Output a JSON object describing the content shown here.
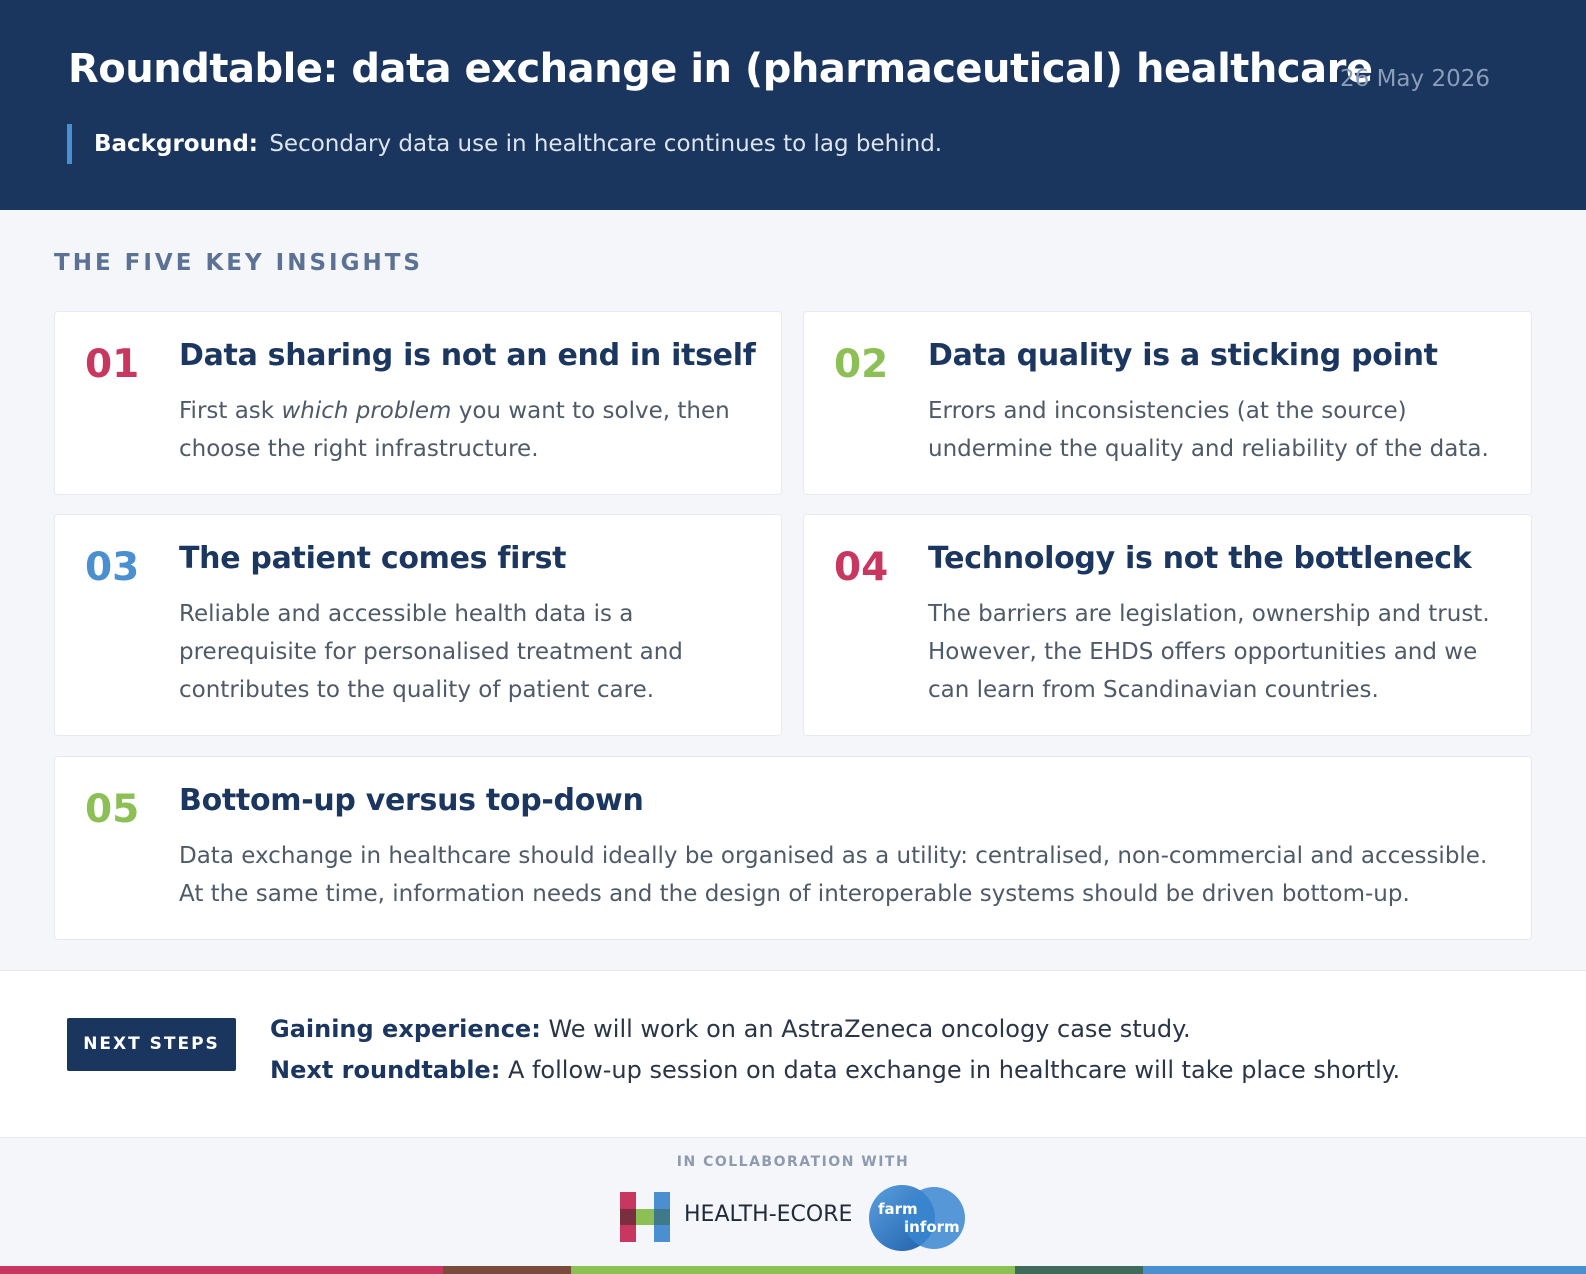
{
  "header": {
    "title": "Roundtable: data exchange in (pharmaceutical) healthcare",
    "date": "26 May 2026",
    "background_label": "Background:",
    "background_text": "Secondary data use in healthcare continues to lag behind."
  },
  "insights": {
    "section_label": "THE FIVE KEY INSIGHTS",
    "items": [
      {
        "number": "01",
        "number_color": "#c8375f",
        "title": "Data sharing is not an end in itself",
        "body_prefix": "First ask",
        "body_emphasis": "which problem",
        "body_line1_rest": "you want to solve, then",
        "body_line2": "choose the right infrastructure."
      },
      {
        "number": "02",
        "number_color": "#8cbf54",
        "title": "Data quality is a sticking point",
        "body_lines": [
          "Errors and inconsistencies (at the source)",
          "undermine the quality and reliability of the data."
        ]
      },
      {
        "number": "03",
        "number_color": "#4a8fd0",
        "title": "The patient comes first",
        "body_lines": [
          "Reliable and accessible health data is a",
          "prerequisite for personalised treatment and",
          "contributes to the quality of patient care."
        ]
      },
      {
        "number": "04",
        "number_color": "#c8375f",
        "title": "Technology is not the bottleneck",
        "body_lines": [
          "The barriers are legislation, ownership and trust.",
          "However, the EHDS offers opportunities and we",
          "can learn from Scandinavian countries."
        ]
      },
      {
        "number": "05",
        "number_color": "#8cbf54",
        "title": "Bottom-up versus top-down",
        "body_lines": [
          "Data exchange in healthcare should ideally be organised as a utility: centralised, non-commercial and accessible.",
          "At the same time, information needs and the design of interoperable systems should be driven bottom-up."
        ]
      }
    ]
  },
  "next_steps": {
    "badge": "NEXT STEPS",
    "items": [
      {
        "label": "Gaining experience:",
        "text": "We will work on an AstraZeneca oncology case study."
      },
      {
        "label": "Next roundtable:",
        "text": "A follow-up session on data exchange in healthcare will take place shortly."
      }
    ]
  },
  "footer": {
    "collab_label": "IN COLLABORATION WITH",
    "logos": [
      {
        "name": "HEALTH-ECORE",
        "icon": "health-ecore-h-logo"
      },
      {
        "name_top": "farm",
        "name_bottom": "inform",
        "icon": "farminform-logo"
      }
    ]
  },
  "colors": {
    "navy": "#1a365e",
    "accent_blue": "#4a8fd0",
    "pink": "#c8375f",
    "green": "#8cbf54",
    "bottom_bar": [
      "#c8375f",
      "#7a4a3a",
      "#8cbf54",
      "#3f6b5a",
      "#4a8fd0"
    ]
  }
}
